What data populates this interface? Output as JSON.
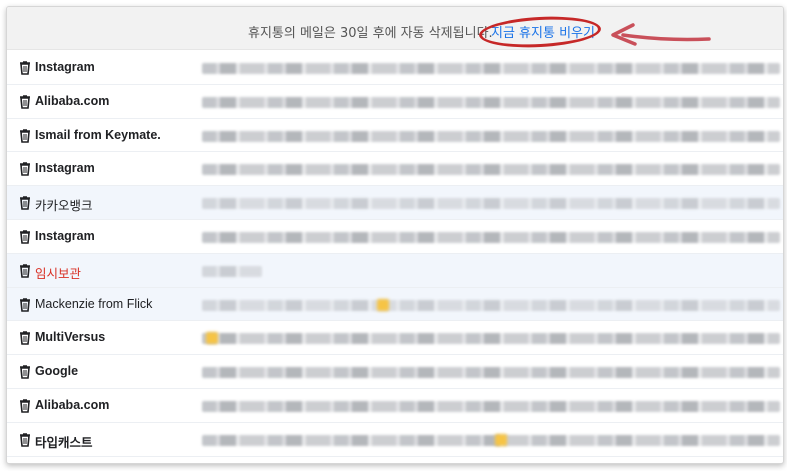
{
  "banner": {
    "message": "휴지통의 메일은 30일 후에 자동 삭제됩니다.",
    "empty_link": "지금 휴지통 비우기"
  },
  "annotations": {
    "circle_color": "#c62828",
    "arrow_color": "#c9505a"
  },
  "rows": [
    {
      "sender": "Instagram"
    },
    {
      "sender": "Alibaba.com"
    },
    {
      "sender": "Ismail from Keymate."
    },
    {
      "sender": "Instagram"
    },
    {
      "sender": "카카오뱅크"
    },
    {
      "sender": "Instagram"
    },
    {
      "sender": "임시보관"
    },
    {
      "sender": "Mackenzie from Flick"
    },
    {
      "sender": "MultiVersus"
    },
    {
      "sender": "Google"
    },
    {
      "sender": "Alibaba.com"
    },
    {
      "sender": "타입캐스트"
    }
  ],
  "colors": {
    "link": "#1a73e8",
    "draft_label": "#d93025",
    "selected_row_bg": "#f2f6fc"
  }
}
